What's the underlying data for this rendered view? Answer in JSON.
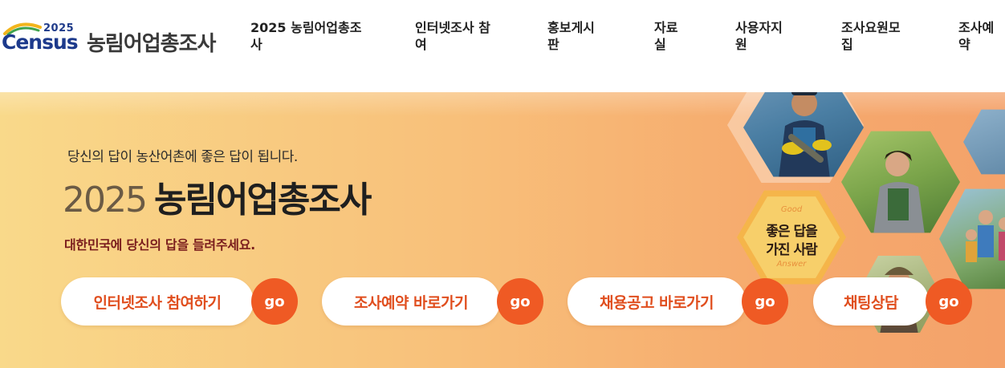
{
  "logo": {
    "year": "2025",
    "brand": "Census",
    "title": "농림어업총조사"
  },
  "nav": {
    "items": [
      {
        "label": "2025 농림어업총조사"
      },
      {
        "label": "인터넷조사 참여"
      },
      {
        "label": "홍보게시판"
      },
      {
        "label": "자료실"
      },
      {
        "label": "사용자지원"
      },
      {
        "label": "조사요원모집"
      },
      {
        "label": "조사예약"
      }
    ]
  },
  "hero": {
    "tagline": "당신의 답이 농산어촌에 좋은 답이 됩니다.",
    "title_year": "2025",
    "title": "농림어업총조사",
    "subtitle": "대한민국에 당신의 답을 들려주세요.",
    "badge": {
      "top": "Good",
      "line1": "좋은 답을",
      "line2": "가진 사람",
      "bottom": "Answer"
    }
  },
  "cta": [
    {
      "label": "인터넷조사 참여하기",
      "go": "go"
    },
    {
      "label": "조사예약 바로가기",
      "go": "go"
    },
    {
      "label": "채용공고 바로가기",
      "go": "go"
    },
    {
      "label": "채팅상담",
      "go": "go"
    }
  ],
  "colors": {
    "accent": "#ef5a24",
    "brand_blue": "#1d3a8c",
    "banner_start": "#f9d98a",
    "banner_end": "#f4a26a"
  }
}
